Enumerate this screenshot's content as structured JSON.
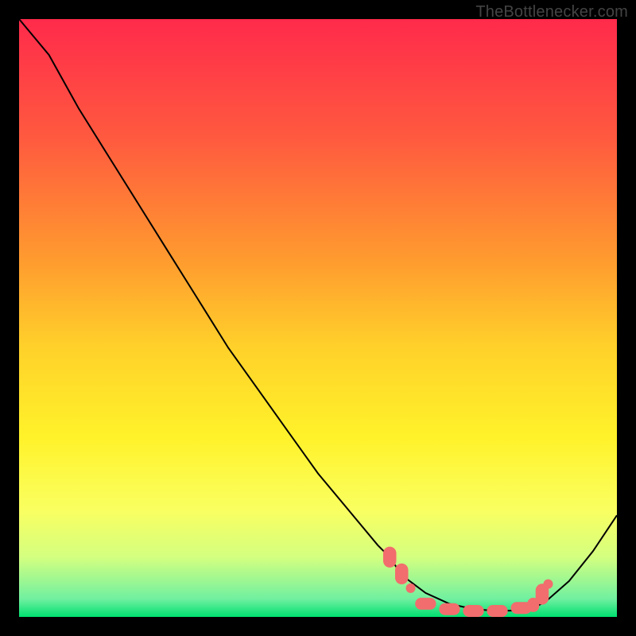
{
  "watermark": "TheBottlenecker.com",
  "chart_data": {
    "type": "line",
    "title": "",
    "xlabel": "",
    "ylabel": "",
    "xlim": [
      0,
      100
    ],
    "ylim": [
      0,
      100
    ],
    "grid": false,
    "background_gradient": {
      "type": "vertical",
      "stops": [
        {
          "offset": 0.0,
          "color": "#ff2a4b"
        },
        {
          "offset": 0.2,
          "color": "#ff5a3f"
        },
        {
          "offset": 0.4,
          "color": "#ff9a2f"
        },
        {
          "offset": 0.55,
          "color": "#ffd12a"
        },
        {
          "offset": 0.7,
          "color": "#fff22a"
        },
        {
          "offset": 0.82,
          "color": "#faff60"
        },
        {
          "offset": 0.9,
          "color": "#d4ff80"
        },
        {
          "offset": 0.97,
          "color": "#70f0a0"
        },
        {
          "offset": 1.0,
          "color": "#00e070"
        }
      ]
    },
    "series": [
      {
        "name": "curve",
        "description": "Black V-shaped bottleneck curve",
        "color": "#000000",
        "stroke_width": 2,
        "x": [
          0,
          5,
          10,
          15,
          20,
          25,
          30,
          35,
          40,
          45,
          50,
          55,
          60,
          62,
          64,
          68,
          72,
          76,
          80,
          84,
          86,
          88,
          92,
          96,
          100
        ],
        "y": [
          100,
          94,
          85,
          77,
          69,
          61,
          53,
          45,
          38,
          31,
          24,
          18,
          12,
          10,
          7,
          4,
          2.2,
          1.3,
          1.0,
          1.1,
          1.5,
          2.5,
          6,
          11,
          17
        ]
      }
    ],
    "markers": {
      "name": "red-dots",
      "description": "Salmon markers near the curve trough",
      "color": "#f26d6d",
      "points": [
        {
          "x": 62,
          "y": 10,
          "w": 2.2,
          "h": 3.5
        },
        {
          "x": 64,
          "y": 7.2,
          "w": 2.2,
          "h": 3.5
        },
        {
          "x": 65.5,
          "y": 4.8,
          "w": 1.6,
          "h": 1.6
        },
        {
          "x": 68,
          "y": 2.2,
          "w": 3.5,
          "h": 2.0
        },
        {
          "x": 72,
          "y": 1.3,
          "w": 3.5,
          "h": 2.0
        },
        {
          "x": 76,
          "y": 1.0,
          "w": 3.5,
          "h": 2.0
        },
        {
          "x": 80,
          "y": 1.0,
          "w": 3.5,
          "h": 2.0
        },
        {
          "x": 84,
          "y": 1.5,
          "w": 3.5,
          "h": 2.0
        },
        {
          "x": 86,
          "y": 2.0,
          "w": 2.0,
          "h": 2.4
        },
        {
          "x": 87.5,
          "y": 3.8,
          "w": 2.2,
          "h": 3.5
        },
        {
          "x": 88.5,
          "y": 5.5,
          "w": 1.6,
          "h": 1.6
        }
      ]
    }
  }
}
